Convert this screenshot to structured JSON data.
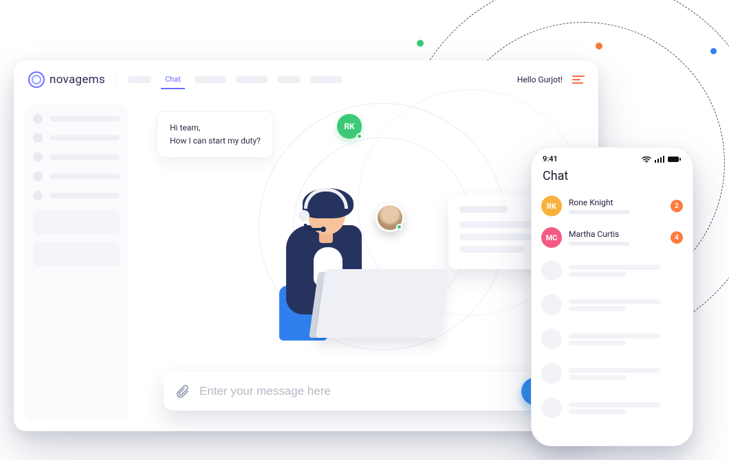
{
  "brand": {
    "name": "novagems"
  },
  "nav": {
    "active_tab": "Chat",
    "greeting": "Hello Gurjot!"
  },
  "chat": {
    "incoming": {
      "line1": "Hi team,",
      "line2": "How I can start my duty?",
      "sender_initials": "RK"
    },
    "composer": {
      "placeholder": "Enter your message here"
    }
  },
  "phone": {
    "time": "9:41",
    "title": "Chat",
    "contacts": [
      {
        "name": "Rone Knight",
        "initials": "RK",
        "color": "#f7b23d",
        "unread": "2"
      },
      {
        "name": "Martha Curtis",
        "initials": "MC",
        "color": "#f25a84",
        "unread": "4"
      }
    ]
  },
  "colors": {
    "accent": "#6a6aff",
    "send": "#2f8ef0",
    "badge": "#ff7a3d"
  }
}
